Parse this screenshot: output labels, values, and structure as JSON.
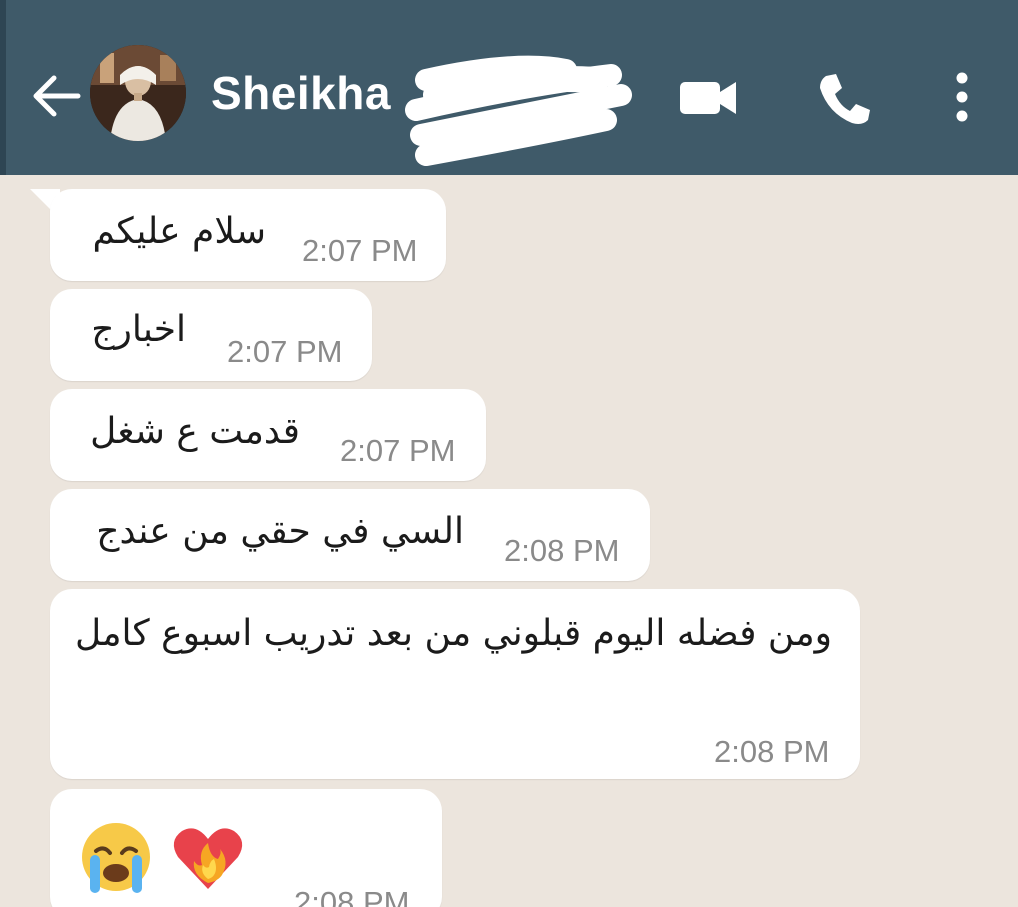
{
  "header": {
    "contact_name": "Sheikha",
    "background_color": "#3f5a69",
    "icons": [
      "back-arrow-icon",
      "avatar",
      "video-call-icon",
      "phone-icon",
      "more-vert-icon"
    ]
  },
  "messages": [
    {
      "text": "سلام عليكم",
      "time": "2:07 PM"
    },
    {
      "text": "اخبارج",
      "time": "2:07 PM"
    },
    {
      "text": "قدمت ع شغل",
      "time": "2:07 PM"
    },
    {
      "text": "السي في حقي من عندج",
      "time": "2:08 PM"
    },
    {
      "text": "ومن فضله اليوم قبلوني من بعد تدريب اسبوع كامل",
      "time": "2:08 PM"
    },
    {
      "emojis": [
        "loudly-crying-face-icon",
        "heart-on-fire-icon"
      ],
      "time": "2:08 PM"
    }
  ],
  "colors": {
    "chat_background": "#ece5dd",
    "bubble": "#ffffff",
    "timestamp": "#8a8a8a"
  }
}
